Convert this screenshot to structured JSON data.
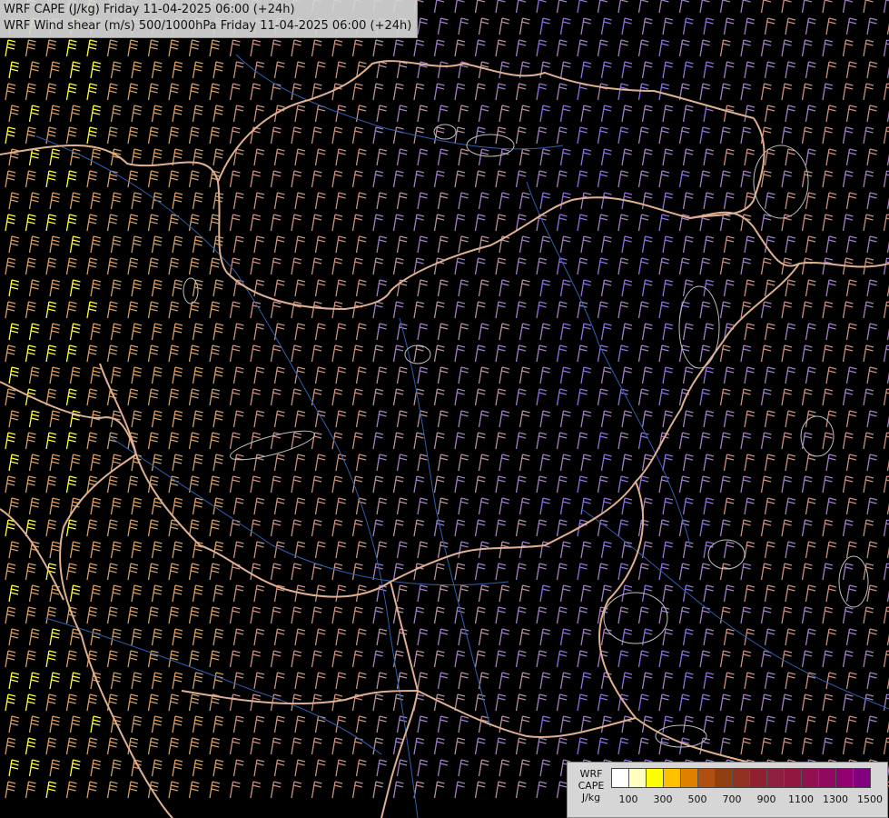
{
  "header": {
    "line1": "WRF CAPE (J/kg) Friday 11-04-2025 06:00 (+24h)",
    "line2": "WRF Wind shear (m/s) 500/1000hPa Friday 11-04-2025 06:00 (+24h)"
  },
  "legend": {
    "label_model": "WRF",
    "label_var": "CAPE",
    "label_unit": "J/kg",
    "colors": [
      "#ffffff",
      "#ffffc0",
      "#ffff00",
      "#ffc000",
      "#e08000",
      "#b05010",
      "#904010",
      "#903020",
      "#902030",
      "#902040",
      "#901840",
      "#901050",
      "#900860",
      "#900070",
      "#800080"
    ],
    "tick_labels": [
      "100",
      "300",
      "500",
      "700",
      "900",
      "1100",
      "1300",
      "1500"
    ]
  },
  "map": {
    "background": "#000000",
    "border_color": "#e0b090",
    "river_color": "#2f5fb0",
    "barb_colors": [
      "#d8a060",
      "#c8a070",
      "#c89080",
      "#b890a0",
      "#a080c0",
      "#9070e0",
      "#ffff40"
    ]
  }
}
